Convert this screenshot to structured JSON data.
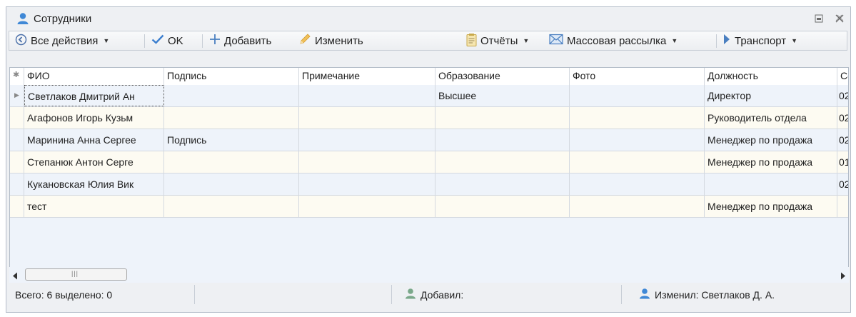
{
  "window": {
    "title": "Сотрудники",
    "restore_icon": "restore-icon",
    "close_icon": "close-icon"
  },
  "toolbar": {
    "all_actions": "Все действия",
    "ok": "OK",
    "add": "Добавить",
    "edit": "Изменить",
    "reports": "Отчёты",
    "mass_mailing": "Массовая рассылка",
    "transport": "Транспорт"
  },
  "grid": {
    "columns": [
      "ФИО",
      "Подпись",
      "Примечание",
      "Образование",
      "Фото",
      "Должность",
      "Со"
    ],
    "rows": [
      [
        "Светлаков Дмитрий Ан",
        "",
        "",
        "Высшее",
        "",
        "Директор",
        "02"
      ],
      [
        "Агафонов Игорь Кузьм",
        "",
        "",
        "",
        "",
        "Руководитель отдела",
        "02"
      ],
      [
        "Маринина Анна Сергее",
        "Подпись",
        "",
        "",
        "",
        "Менеджер по продажа",
        "02"
      ],
      [
        "Степанюк Антон Серге",
        "",
        "",
        "",
        "",
        "Менеджер по продажа",
        "01"
      ],
      [
        "Кукановская Юлия Вик",
        "",
        "",
        "",
        "",
        "",
        "02"
      ],
      [
        "тест",
        "",
        "",
        "",
        "",
        "Менеджер по продажа",
        ""
      ]
    ]
  },
  "status": {
    "total": "Всего: 6 выделено: 0",
    "added_by": "Добавил:",
    "changed_by": "Изменил: Светлаков Д. А."
  },
  "colors": {
    "row_odd": "#eef3fa",
    "row_even": "#fdfbf2",
    "user_icon_blue": "#3f88d6",
    "user_icon_green": "#7aa88a",
    "ok_check": "#3c7fcf",
    "edit_pencil": "#e8b84a",
    "mail_icon": "#4a7fc0"
  }
}
